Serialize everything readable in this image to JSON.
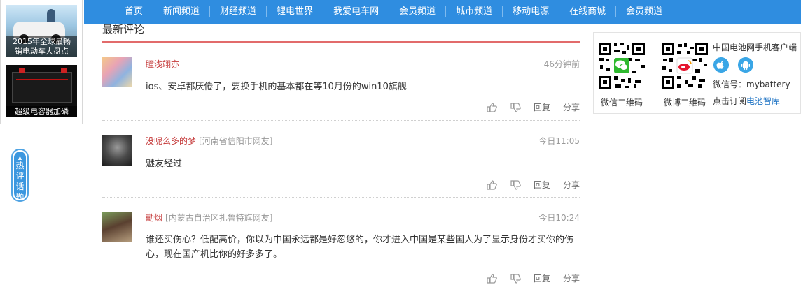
{
  "nav": {
    "items": [
      "首页",
      "新闻频道",
      "财经频道",
      "锂电世界",
      "我爱电车网",
      "会员频道",
      "城市频道",
      "移动电源",
      "在线商城",
      "会员频道"
    ]
  },
  "side": {
    "cards": [
      {
        "caption_line1": "2015年全球最畅",
        "caption_line2": "销电动车大盘点"
      },
      {
        "caption_line1": "超级电容器加磷",
        "caption_line2": ""
      }
    ],
    "hot_tab": [
      "热",
      "评",
      "话",
      "题"
    ]
  },
  "comments": {
    "title": "最新评论",
    "items": [
      {
        "user": "瞳浅翊亦",
        "location": "",
        "time": "46分钟前",
        "text": "ios、安卓都厌倦了，要换手机的基本都在等10月份的win10旗舰"
      },
      {
        "user": "没呢么多的梦",
        "location": "[河南省信阳市网友]",
        "time": "今日11:05",
        "text": "魅友经过"
      },
      {
        "user": "勳烟",
        "location": "[内蒙古自治区扎鲁特旗网友]",
        "time": "今日10:24",
        "text": "谁还买伤心？低配高价，你以为中国永远都是好忽悠的，你才进入中国是某些国人为了显示身份才买你的伤心，现在国产机比你的好多多了。"
      }
    ],
    "reply_label": "回复",
    "share_label": "分享"
  },
  "right": {
    "wechat_caption": "微信二维码",
    "weibo_caption": "微博二维码",
    "client_title": "中国电池网手机客户端",
    "wechat_id": "微信号：mybattery",
    "subscribe_prefix": "点击订阅",
    "subscribe_link": "电池智库"
  },
  "colors": {
    "nav_bg": "#2f8de0",
    "username": "#c53b3b",
    "title_underline": "#e26b6b",
    "link": "#1e73c4"
  }
}
